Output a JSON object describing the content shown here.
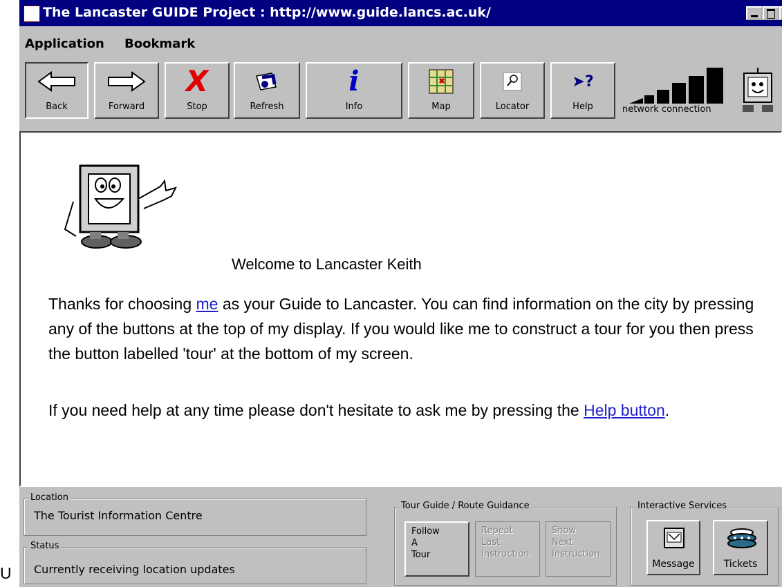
{
  "window": {
    "title": "The Lancaster GUIDE Project : http://www.guide.lancs.ac.uk/"
  },
  "menu": [
    "Application",
    "Bookmark"
  ],
  "toolbar": {
    "back": "Back",
    "forward": "Forward",
    "stop": "Stop",
    "refresh": "Refresh",
    "info": "Info",
    "map": "Map",
    "locator": "Locator",
    "help": "Help",
    "network": "network connection"
  },
  "content": {
    "welcome": "Welcome to Lancaster Keith",
    "p1_before": "Thanks for choosing ",
    "p1_link": "me",
    "p1_after": " as your Guide to Lancaster. You can find information on the city by pressing any of the buttons at the top of my display. If you would like me to construct a tour for you then press the button labelled 'tour' at the bottom of my screen.",
    "p2_before": "If you need help at any time please don't hesitate to ask me by pressing the ",
    "p2_link": "Help button",
    "p2_after": "."
  },
  "status": {
    "location_label": "Location",
    "location_value": "The Tourist Information Centre",
    "status_label": "Status",
    "status_value": "Currently receiving location updates"
  },
  "tour": {
    "group_label": "Tour Guide / Route Guidance",
    "follow": "Follow\nA\nTour",
    "repeat": "Repeat\nLast\nInstruction",
    "next": "Show\nNext\nInstruction"
  },
  "services": {
    "group_label": "Interactive Services",
    "message": "Message",
    "tickets": "Tickets"
  },
  "stray_char": "U"
}
